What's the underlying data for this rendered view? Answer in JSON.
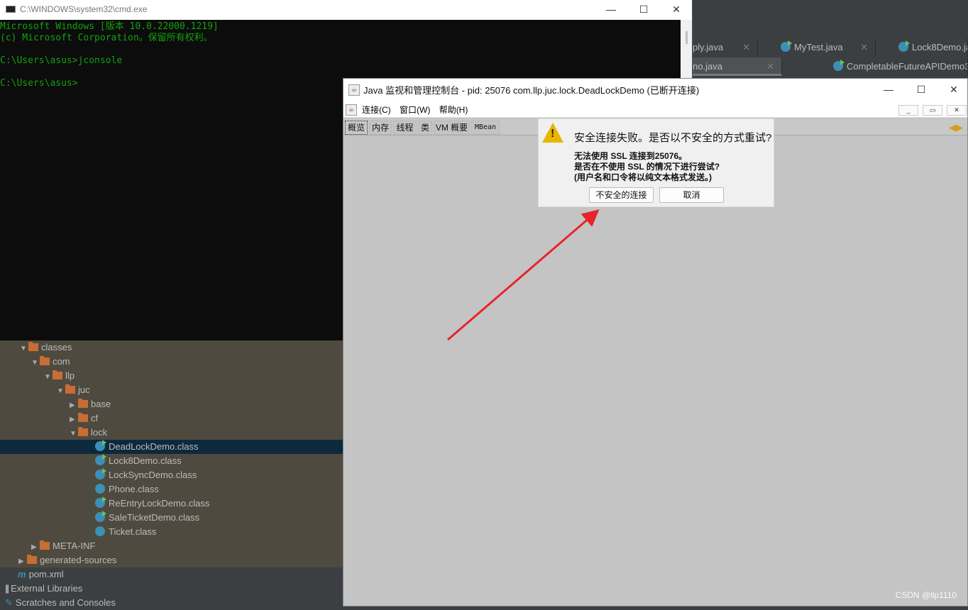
{
  "ide": {
    "tabs_row1": [
      "ply.java",
      "MyTest.java",
      "Lock8Demo.ja"
    ],
    "tabs_row2": [
      "no.java",
      "CompletableFutureAPIDemo3"
    ]
  },
  "cmd": {
    "title": "C:\\WINDOWS\\system32\\cmd.exe",
    "lines": [
      "Microsoft Windows [版本 10.0.22000.1219]",
      "(c) Microsoft Corporation。保留所有权利。",
      "",
      "C:\\Users\\asus>jconsole",
      "",
      "C:\\Users\\asus>"
    ]
  },
  "tree": {
    "items": [
      {
        "label": "classes",
        "type": "folder"
      },
      {
        "label": "com",
        "type": "folder"
      },
      {
        "label": "llp",
        "type": "folder"
      },
      {
        "label": "juc",
        "type": "folder"
      },
      {
        "label": "base",
        "type": "folder"
      },
      {
        "label": "cf",
        "type": "folder"
      },
      {
        "label": "lock",
        "type": "folder"
      },
      {
        "label": "DeadLockDemo.class",
        "type": "class"
      },
      {
        "label": "Lock8Demo.class",
        "type": "class"
      },
      {
        "label": "LockSyncDemo.class",
        "type": "class"
      },
      {
        "label": "Phone.class",
        "type": "class"
      },
      {
        "label": "ReEntryLockDemo.class",
        "type": "class"
      },
      {
        "label": "SaleTicketDemo.class",
        "type": "class"
      },
      {
        "label": "Ticket.class",
        "type": "class"
      },
      {
        "label": "META-INF",
        "type": "folder"
      },
      {
        "label": "generated-sources",
        "type": "folder"
      },
      {
        "label": "pom.xml",
        "type": "maven"
      },
      {
        "label": "External Libraries",
        "type": "library"
      },
      {
        "label": "Scratches and Consoles",
        "type": "scratch"
      }
    ]
  },
  "jconsole": {
    "title": "Java 监视和管理控制台 - pid: 25076 com.llp.juc.lock.DeadLockDemo (已断开连接)",
    "menu": [
      "连接(C)",
      "窗口(W)",
      "帮助(H)"
    ],
    "tabs": [
      "概览",
      "内存",
      "线程",
      "类",
      "VM 概要",
      "MBean"
    ],
    "active_tab": "概览"
  },
  "dialog": {
    "heading": "安全连接失败。是否以不安全的方式重试?",
    "lines": [
      "无法使用 SSL 连接到25076。",
      "是否在不使用 SSL 的情况下进行尝试?",
      "(用户名和口令将以纯文本格式发送。)"
    ],
    "insecure_button": "不安全的连接",
    "cancel_button": "取消"
  },
  "annotation_color": "#e8242a",
  "watermark": "CSDN @llp1110"
}
